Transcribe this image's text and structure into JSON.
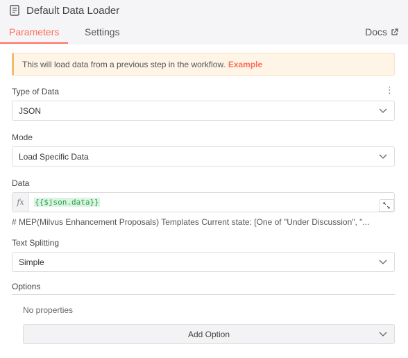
{
  "header": {
    "title": "Default Data Loader",
    "tabs": [
      {
        "label": "Parameters",
        "active": true
      },
      {
        "label": "Settings",
        "active": false
      }
    ],
    "docs_label": "Docs"
  },
  "notice": {
    "text": "This will load data from a previous step in the workflow.",
    "link": "Example"
  },
  "fields": {
    "type_of_data": {
      "label": "Type of Data",
      "value": "JSON"
    },
    "mode": {
      "label": "Mode",
      "value": "Load Specific Data"
    },
    "data": {
      "label": "Data",
      "fx": "fx",
      "expression": "{{$json.data}}",
      "preview": "# MEP(Milvus Enhancement Proposals) Templates Current state: [One of \"Under Discussion\", \"..."
    },
    "text_splitting": {
      "label": "Text Splitting",
      "value": "Simple"
    }
  },
  "options": {
    "label": "Options",
    "empty_text": "No properties",
    "add_button": "Add Option"
  },
  "colors": {
    "accent": "#ff6d5a",
    "notice_bg": "#fef5e7",
    "expression_text": "#2d9a4e",
    "expression_bg": "#d9f5e1"
  }
}
